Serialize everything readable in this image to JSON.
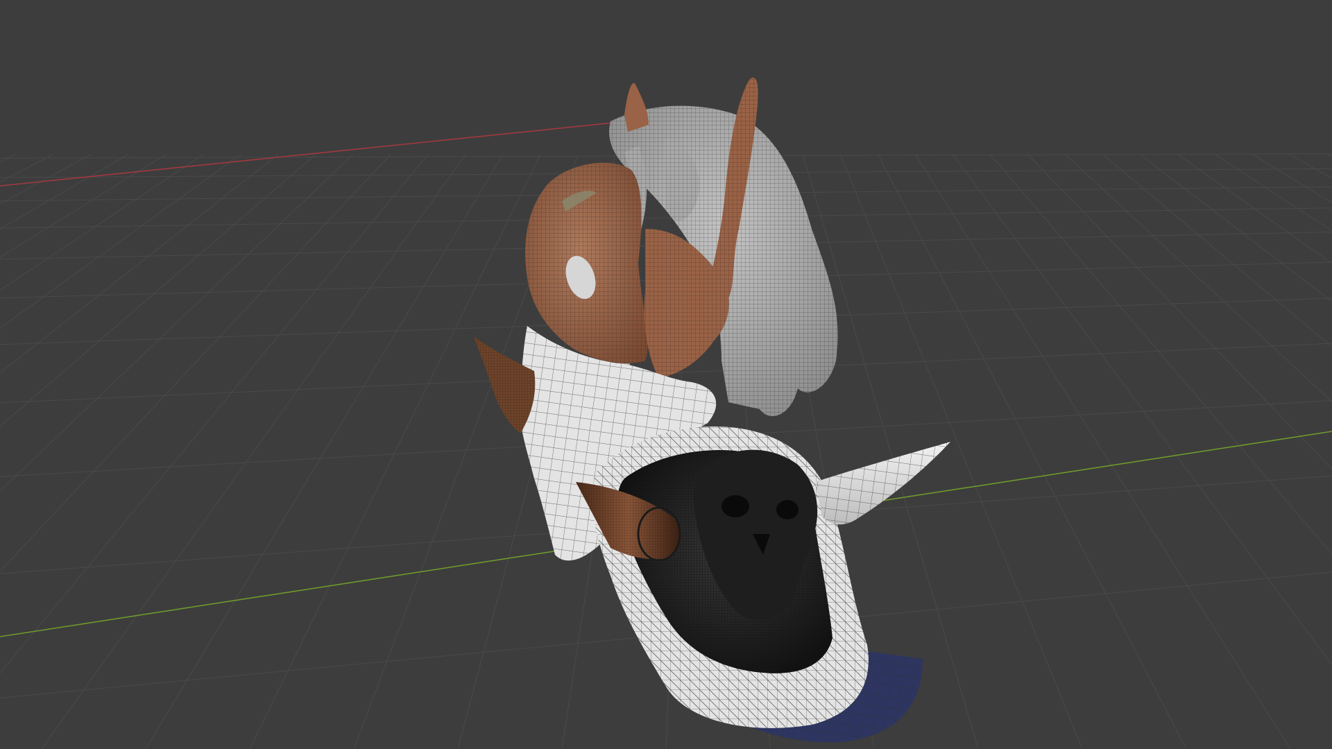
{
  "viewport": {
    "background": "#3d3d3d",
    "grid_color": "#4a4a4a",
    "x_axis_color": "#a3393f",
    "y_axis_color": "#6f9a2b"
  },
  "model": {
    "skin_color": "#9a6246",
    "hair_color": "#a9a9a9",
    "cloth_color": "#e4e4e4",
    "shield_dark_color": "#1e1e1e",
    "spike_color": "#6f432a",
    "pants_color": "#2d3560"
  }
}
